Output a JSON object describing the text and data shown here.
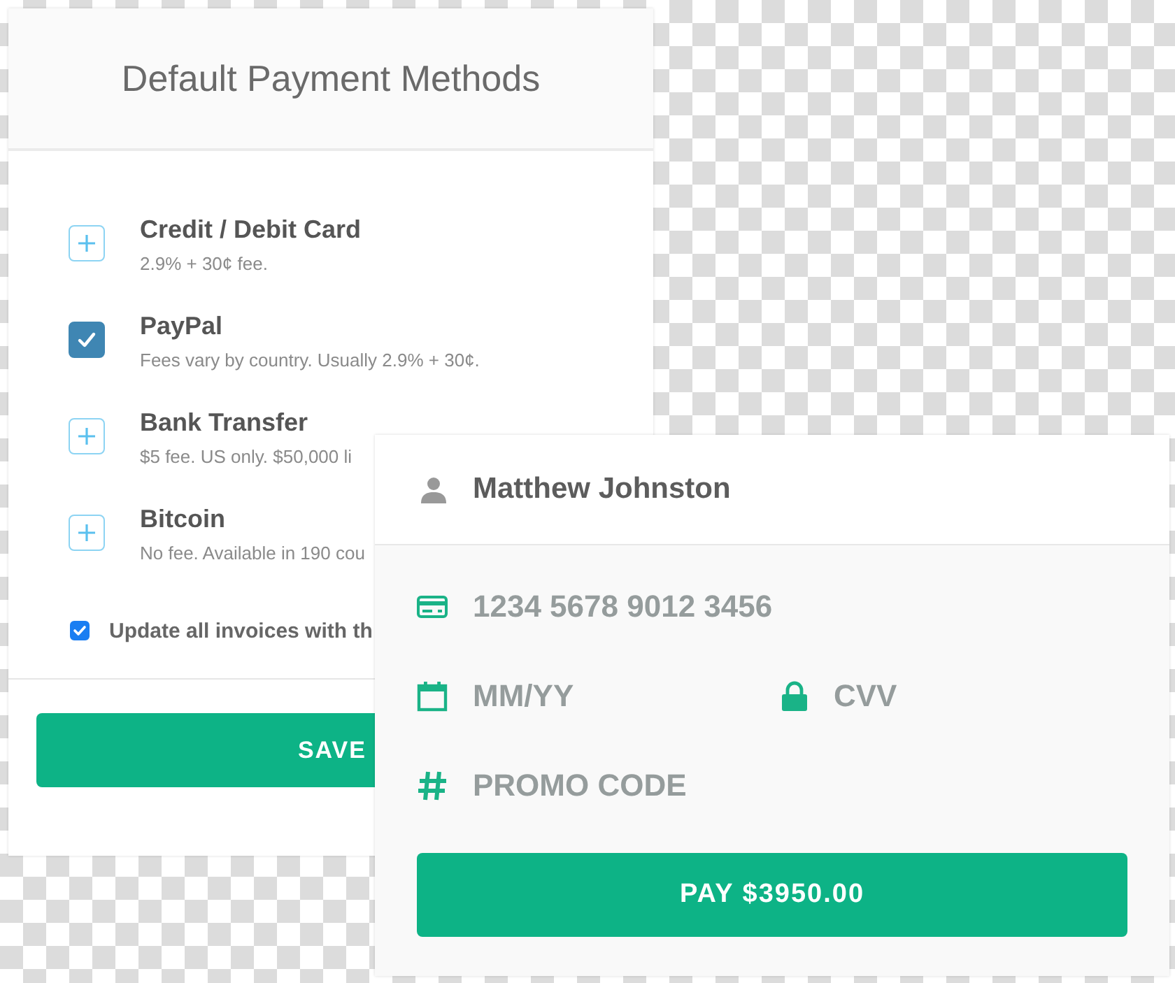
{
  "payment_methods_card": {
    "title": "Default Payment Methods",
    "methods": [
      {
        "name": "Credit / Debit Card",
        "description": "2.9% + 30¢ fee.",
        "selected": false
      },
      {
        "name": "PayPal",
        "description": "Fees vary by country. Usually 2.9% + 30¢.",
        "selected": true
      },
      {
        "name": "Bank Transfer",
        "description": "$5 fee. US only. $50,000 li",
        "selected": false
      },
      {
        "name": "Bitcoin",
        "description": "No fee. Available in 190 cou",
        "selected": false
      }
    ],
    "update_invoices": {
      "label": "Update all invoices with th",
      "checked": true
    },
    "save_button": "SAVE"
  },
  "checkout_card": {
    "name": "Matthew Johnston",
    "fields": [
      {
        "kind": "card",
        "placeholder": "1234 5678 9012 3456"
      },
      {
        "kind": "date",
        "placeholder": "MM/YY"
      },
      {
        "kind": "lock",
        "placeholder": "CVV"
      },
      {
        "kind": "hash",
        "placeholder": "PROMO CODE"
      }
    ],
    "pay_button": "PAY $3950.00"
  }
}
